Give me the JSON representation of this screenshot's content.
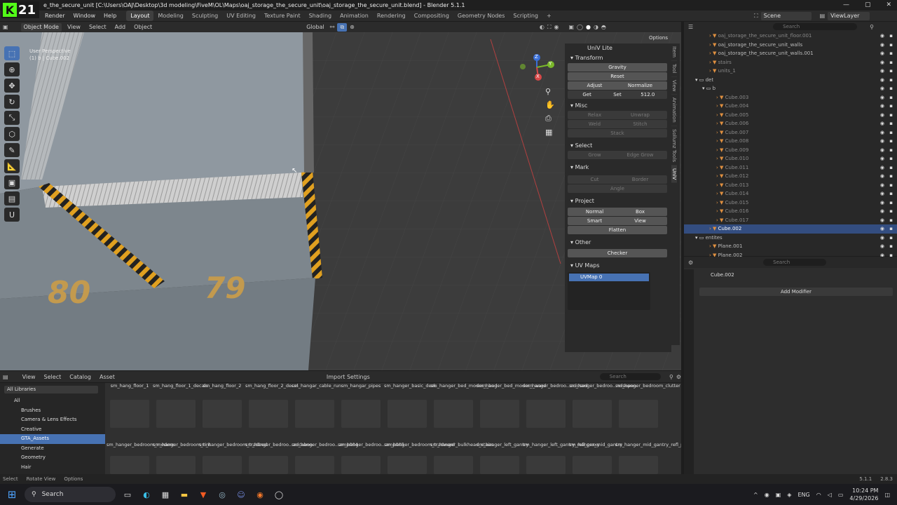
{
  "window_title": "\\Desktop\\3d modeling\\FiveM\\OL\\Maps\\oaj_storage_the_secure_unit\\oaj_storage_the_secure_unit.blend] - Blender 5.1.1",
  "title_prefix": "e_the_secure_unit [C:\\Users\\OAJ",
  "stream_logo": {
    "letter": "K",
    "number": "21"
  },
  "menus": [
    "Render",
    "Window",
    "Help"
  ],
  "workspaces": [
    "Layout",
    "Modeling",
    "Sculpting",
    "UV Editing",
    "Texture Paint",
    "Shading",
    "Animation",
    "Rendering",
    "Compositing",
    "Geometry Nodes",
    "Scripting"
  ],
  "active_workspace": "Layout",
  "scene": {
    "label": "Scene",
    "view_layer": "ViewLayer"
  },
  "viewport_header": {
    "mode": "Object Mode",
    "menus": [
      "View",
      "Select",
      "Add",
      "Object"
    ],
    "orientation": "Global",
    "options": "Options"
  },
  "viewport_info": {
    "line1": "User Perspective",
    "line2": "(1) b | Cube.002"
  },
  "floor_numbers": [
    "80",
    "79"
  ],
  "gizmo_axes": {
    "x": "X",
    "y": "Y",
    "z": "Z"
  },
  "npanel": {
    "title": "UniV Lite",
    "sections": {
      "transform": "Transform",
      "misc": "Misc",
      "select": "Select",
      "mark": "Mark",
      "project": "Project",
      "other": "Other",
      "uvmaps": "UV Maps"
    },
    "gravity": "Gravity",
    "reset": "Reset",
    "adjust": "Adjust",
    "normalize": "Normalize",
    "get": "Get",
    "set": "Set",
    "set_value": "512.0",
    "relax": "Relax",
    "unwrap": "Unwrap",
    "weld": "Weld",
    "stitch": "Stitch",
    "stack": "Stack",
    "grow": "Grow",
    "edge_grow": "Edge Grow",
    "cut": "Cut",
    "border": "Border",
    "angle": "Angle",
    "normal": "Normal",
    "box": "Box",
    "smart": "Smart",
    "view": "View",
    "flatten": "Flatten",
    "checker": "Checker",
    "uvmap_item": "UVMap 0"
  },
  "side_tabs": [
    "Item",
    "Tool",
    "View",
    "Animation",
    "Sollumz Tools",
    "UniV"
  ],
  "outliner": {
    "search_placeholder": "Search",
    "rows": [
      {
        "label": "oaj_storage_the_secure_unit_floor.001",
        "indent": 3,
        "dim": true
      },
      {
        "label": "oaj_storage_the_secure_unit_walls",
        "indent": 3,
        "dim": false
      },
      {
        "label": "oaj_storage_the_secure_unit_walls.001",
        "indent": 3,
        "dim": false
      },
      {
        "label": "stairs",
        "indent": 3,
        "dim": true
      },
      {
        "label": "units_1",
        "indent": 3,
        "dim": true
      },
      {
        "label": "det",
        "indent": 1,
        "dim": false
      },
      {
        "label": "b",
        "indent": 2,
        "dim": false
      },
      {
        "label": "Cube.003",
        "indent": 4,
        "dim": true
      },
      {
        "label": "Cube.004",
        "indent": 4,
        "dim": true
      },
      {
        "label": "Cube.005",
        "indent": 4,
        "dim": true
      },
      {
        "label": "Cube.006",
        "indent": 4,
        "dim": true
      },
      {
        "label": "Cube.007",
        "indent": 4,
        "dim": true
      },
      {
        "label": "Cube.008",
        "indent": 4,
        "dim": true
      },
      {
        "label": "Cube.009",
        "indent": 4,
        "dim": true
      },
      {
        "label": "Cube.010",
        "indent": 4,
        "dim": true
      },
      {
        "label": "Cube.011",
        "indent": 4,
        "dim": true
      },
      {
        "label": "Cube.012",
        "indent": 4,
        "dim": true
      },
      {
        "label": "Cube.013",
        "indent": 4,
        "dim": true
      },
      {
        "label": "Cube.014",
        "indent": 4,
        "dim": true
      },
      {
        "label": "Cube.015",
        "indent": 4,
        "dim": true
      },
      {
        "label": "Cube.016",
        "indent": 4,
        "dim": true
      },
      {
        "label": "Cube.017",
        "indent": 4,
        "dim": true
      },
      {
        "label": "Cube.002",
        "indent": 3,
        "dim": false,
        "selected": true
      },
      {
        "label": "entites",
        "indent": 1,
        "dim": false
      },
      {
        "label": "Plane.001",
        "indent": 3,
        "dim": false
      },
      {
        "label": "Plane.002",
        "indent": 3,
        "dim": false
      }
    ]
  },
  "properties": {
    "search_placeholder": "Search",
    "object_name": "Cube.002",
    "add_modifier": "Add Modifier"
  },
  "asset_browser": {
    "menus": [
      "View",
      "Select",
      "Catalog",
      "Asset"
    ],
    "import_settings": "Import Settings",
    "search_placeholder": "Search",
    "library": "All Libraries",
    "catalogs": [
      "All",
      "Brushes",
      "Camera & Lens Effects",
      "Creative",
      "GTA_Assets",
      "Generate",
      "Geometry",
      "Hair"
    ],
    "selected_catalog": "GTA_Assets",
    "row1": [
      "sm_hang_floor_1",
      "sm_hang_floor_1_decals",
      "sm_hang_floor_2",
      "sm_hang_floor_2_decal",
      "sm_hangar_cable_run",
      "sm_hangar_pipes",
      "sm_hanger_basic_desk",
      "sm_hanger_bed_modern_bed",
      "sm_hanger_bed_modern_ward",
      "sm_hanger_bedroo...sclosed",
      "sm_hanger_bedroo...ndsopen",
      "sm_hanger_bedroom_clutter"
    ],
    "row2": [
      "sm_hanger_bedroom_modern",
      "sm_hanger_bedroom_tint",
      "sm_hanger_bedroom_tradbed",
      "sm_hanger_bedroo...adcabon",
      "sm_hanger_bedroo...amp004",
      "sm_hanger_bedroo...amp005",
      "sm_hanger_bedroom_tradward",
      "sm_hanger_bulkhead_stairs",
      "sm_hanger_left_gantry",
      "sm_hanger_left_gantry_refl_proxy",
      "sm_hanger_mid_gantry",
      "sm_hanger_mid_gantry_refl_proxy"
    ]
  },
  "status": {
    "select": "Select",
    "rotate": "Rotate View",
    "options": "Options",
    "version": "5.1.1",
    "extra": "2.8.3"
  },
  "taskbar": {
    "search": "Search",
    "lang": "ENG",
    "time": "10:24 PM",
    "date": "4/29/2026"
  }
}
